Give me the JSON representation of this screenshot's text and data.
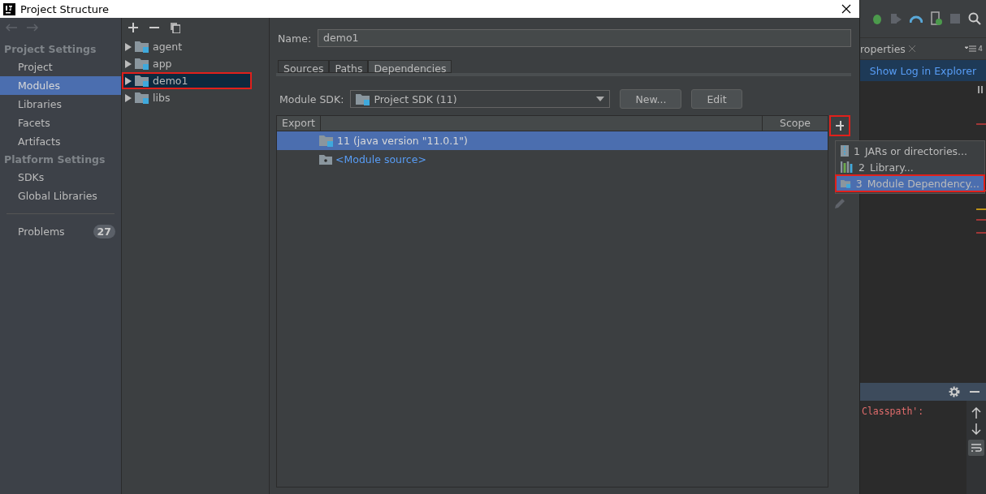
{
  "window": {
    "title": "Project Structure"
  },
  "sidebar": {
    "sections": [
      {
        "heading": "Project Settings",
        "items": [
          {
            "label": "Project",
            "selected": false
          },
          {
            "label": "Modules",
            "selected": true
          },
          {
            "label": "Libraries",
            "selected": false
          },
          {
            "label": "Facets",
            "selected": false
          },
          {
            "label": "Artifacts",
            "selected": false
          }
        ]
      },
      {
        "heading": "Platform Settings",
        "items": [
          {
            "label": "SDKs",
            "selected": false
          },
          {
            "label": "Global Libraries",
            "selected": false
          }
        ]
      }
    ],
    "problems": {
      "label": "Problems",
      "count": "27"
    }
  },
  "module_tree": {
    "items": [
      {
        "label": "agent",
        "selected": false
      },
      {
        "label": "app",
        "selected": false
      },
      {
        "label": "demo1",
        "selected": true
      },
      {
        "label": "libs",
        "selected": false
      }
    ]
  },
  "module": {
    "name_label": "Name:",
    "name": "demo1",
    "tabs": [
      {
        "label": "Sources",
        "selected": false
      },
      {
        "label": "Paths",
        "selected": false
      },
      {
        "label": "Dependencies",
        "selected": true
      }
    ],
    "sdk_label": "Module SDK:",
    "sdk": "Project SDK (11)",
    "buttons": [
      "New...",
      "Edit"
    ],
    "table": {
      "columns": [
        "Export",
        "Scope"
      ],
      "rows": [
        {
          "text": "11 (java version \"11.0.1\")",
          "kind": "sdk",
          "selected": true
        },
        {
          "text": "<Module source>",
          "kind": "source",
          "selected": false
        }
      ]
    }
  },
  "add_menu": {
    "items": [
      {
        "number": "1",
        "label": "JARs or directories...",
        "kind": "jar",
        "selected": false
      },
      {
        "number": "2",
        "label": "Library...",
        "kind": "library",
        "selected": false
      },
      {
        "number": "3",
        "label": "Module Dependency...",
        "kind": "module",
        "selected": true
      }
    ]
  },
  "ide": {
    "tab": "roperties",
    "tab_count": "4",
    "banner": "Show Log in Explorer",
    "console_text": "Classpath':"
  }
}
